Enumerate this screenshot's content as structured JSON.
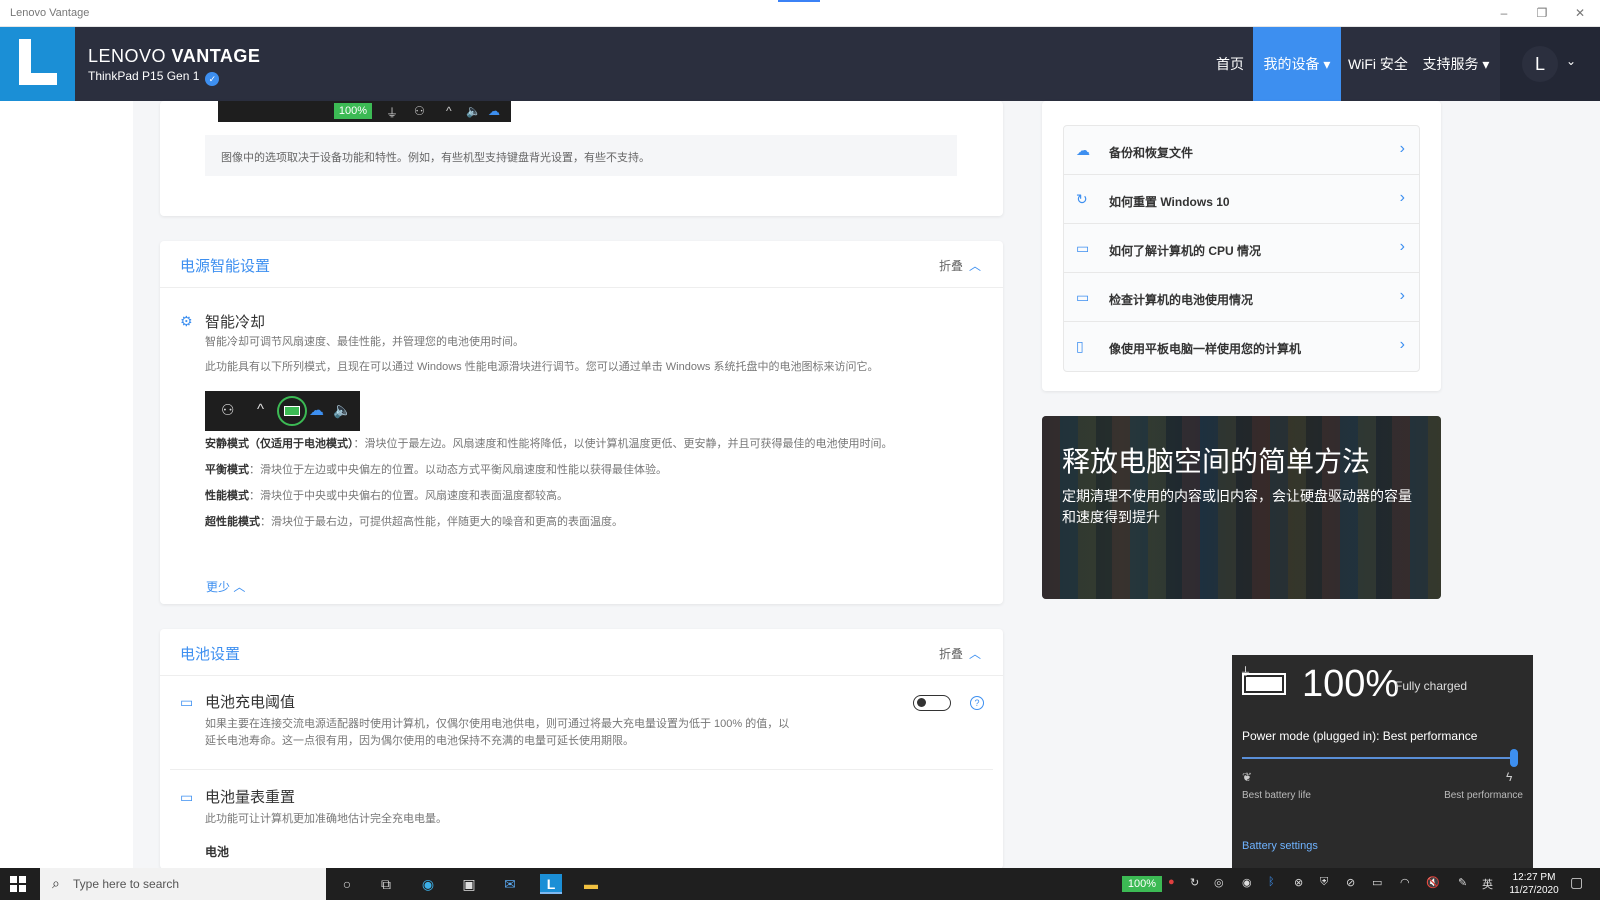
{
  "window": {
    "title": "Lenovo Vantage"
  },
  "header": {
    "brand_light": "LENOVO",
    "brand_bold": "VANTAGE",
    "device": "ThinkPad P15 Gen 1",
    "nav": [
      {
        "label": "首页"
      },
      {
        "label": "我的设备 ▾"
      },
      {
        "label": "WiFi 安全"
      },
      {
        "label": "支持服务 ▾"
      }
    ],
    "avatar_letter": "L"
  },
  "top_card": {
    "battery_pct": "100%",
    "note": "图像中的选项取决于设备功能和特性。例如，有些机型支持键盘背光设置，有些不支持。"
  },
  "power_section": {
    "title": "电源智能设置",
    "collapse_label": "折叠",
    "feature_title": "智能冷却",
    "desc1": "智能冷却可调节风扇速度、最佳性能，并管理您的电池使用时间。",
    "desc2": "此功能具有以下所列模式，且现在可以通过 Windows 性能电源滑块进行调节。您可以通过单击 Windows 系统托盘中的电池图标来访问它。",
    "modes": [
      {
        "name": "安静模式（仅适用于电池模式）",
        "text": "：滑块位于最左边。风扇速度和性能将降低，以使计算机温度更低、更安静，并且可获得最佳的电池使用时间。"
      },
      {
        "name": "平衡模式",
        "text": "：滑块位于左边或中央偏左的位置。以动态方式平衡风扇速度和性能以获得最佳体验。"
      },
      {
        "name": "性能模式",
        "text": "：滑块位于中央或中央偏右的位置。风扇速度和表面温度都较高。"
      },
      {
        "name": "超性能模式",
        "text": "：滑块位于最右边，可提供超高性能，伴随更大的噪音和更高的表面温度。"
      }
    ],
    "less_link": "更少"
  },
  "battery_section": {
    "title": "电池设置",
    "collapse_label": "折叠",
    "threshold_title": "电池充电阈值",
    "threshold_desc1": "如果主要在连接交流电源适配器时使用计算机，仅偶尔使用电池供电，则可通过将最大充电量设置为低于 100% 的值，以",
    "threshold_desc2": "延长电池寿命。这一点很有用，因为偶尔使用的电池保持不充满的电量可延长使用期限。",
    "threshold_enabled": false,
    "gauge_title": "电池量表重置",
    "gauge_desc": "此功能可让计算机更加准确地估计完全充电电量。",
    "battery_label": "电池"
  },
  "links": [
    {
      "icon": "cloud-backup-icon",
      "label": "备份和恢复文件"
    },
    {
      "icon": "refresh-icon",
      "label": "如何重置 Windows 10"
    },
    {
      "icon": "laptop-icon",
      "label": "如何了解计算机的 CPU 情况"
    },
    {
      "icon": "battery-icon",
      "label": "检查计算机的电池使用情况"
    },
    {
      "icon": "tablet-icon",
      "label": "像使用平板电脑一样使用您的计算机"
    }
  ],
  "promo": {
    "title": "释放电脑空间的简单方法",
    "desc": "定期清理不使用的内容或旧内容，会让硬盘驱动器的容量和速度得到提升"
  },
  "battery_flyout": {
    "percent": "100%",
    "status": "Fully charged",
    "mode": "Power mode (plugged in): Best performance",
    "slider_level": 1.0,
    "left_label": "Best battery life",
    "right_label": "Best performance",
    "settings_link": "Battery settings"
  },
  "taskbar": {
    "search_placeholder": "Type here to search",
    "tray_pct": "100%",
    "ime": "英",
    "time": "12:27 PM",
    "date": "11/27/2020"
  }
}
